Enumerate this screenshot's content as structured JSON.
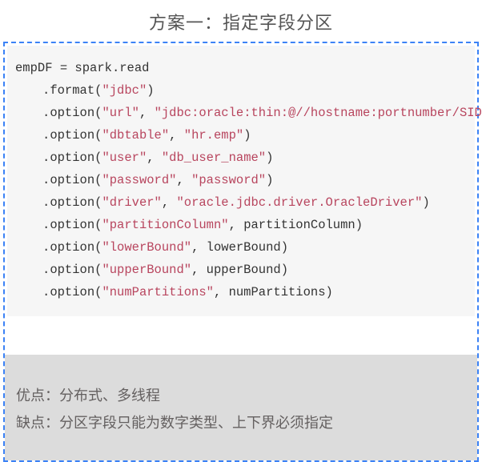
{
  "title": "方案一：指定字段分区",
  "code": {
    "line0_a": "empDF ",
    "line0_b": "=",
    "line0_c": " spark",
    "line0_d": ".",
    "line0_e": "read",
    "l1_a": ".",
    "l1_b": "format",
    "l1_c": "(",
    "l1_d": "\"jdbc\"",
    "l1_e": ")",
    "l2_a": ".",
    "l2_b": "option",
    "l2_c": "(",
    "l2_d": "\"url\"",
    "l2_e": ",",
    "l2_f": " ",
    "l2_g": "\"jdbc:oracle:thin:@//hostname:portnumber/SID\"",
    "l2_h": ")",
    "l3_a": ".",
    "l3_b": "option",
    "l3_c": "(",
    "l3_d": "\"dbtable\"",
    "l3_e": ",",
    "l3_f": " ",
    "l3_g": "\"hr.emp\"",
    "l3_h": ")",
    "l4_a": ".",
    "l4_b": "option",
    "l4_c": "(",
    "l4_d": "\"user\"",
    "l4_e": ",",
    "l4_f": " ",
    "l4_g": "\"db_user_name\"",
    "l4_h": ")",
    "l5_a": ".",
    "l5_b": "option",
    "l5_c": "(",
    "l5_d": "\"password\"",
    "l5_e": ",",
    "l5_f": " ",
    "l5_g": "\"password\"",
    "l5_h": ")",
    "l6_a": ".",
    "l6_b": "option",
    "l6_c": "(",
    "l6_d": "\"driver\"",
    "l6_e": ",",
    "l6_f": " ",
    "l6_g": "\"oracle.jdbc.driver.OracleDriver\"",
    "l6_h": ")",
    "l7_a": ".",
    "l7_b": "option",
    "l7_c": "(",
    "l7_d": "\"partitionColumn\"",
    "l7_e": ",",
    "l7_f": " partitionColumn",
    "l7_g": ")",
    "l8_a": ".",
    "l8_b": "option",
    "l8_c": "(",
    "l8_d": "\"lowerBound\"",
    "l8_e": ",",
    "l8_f": " lowerBound",
    "l8_g": ")",
    "l9_a": ".",
    "l9_b": "option",
    "l9_c": "(",
    "l9_d": "\"upperBound\"",
    "l9_e": ",",
    "l9_f": " upperBound",
    "l9_g": ")",
    "l10_a": ".",
    "l10_b": "option",
    "l10_c": "(",
    "l10_d": "\"numPartitions\"",
    "l10_e": ",",
    "l10_f": " numPartitions",
    "l10_g": ")"
  },
  "pros": "优点：分布式、多线程",
  "cons": "缺点：分区字段只能为数字类型、上下界必须指定"
}
